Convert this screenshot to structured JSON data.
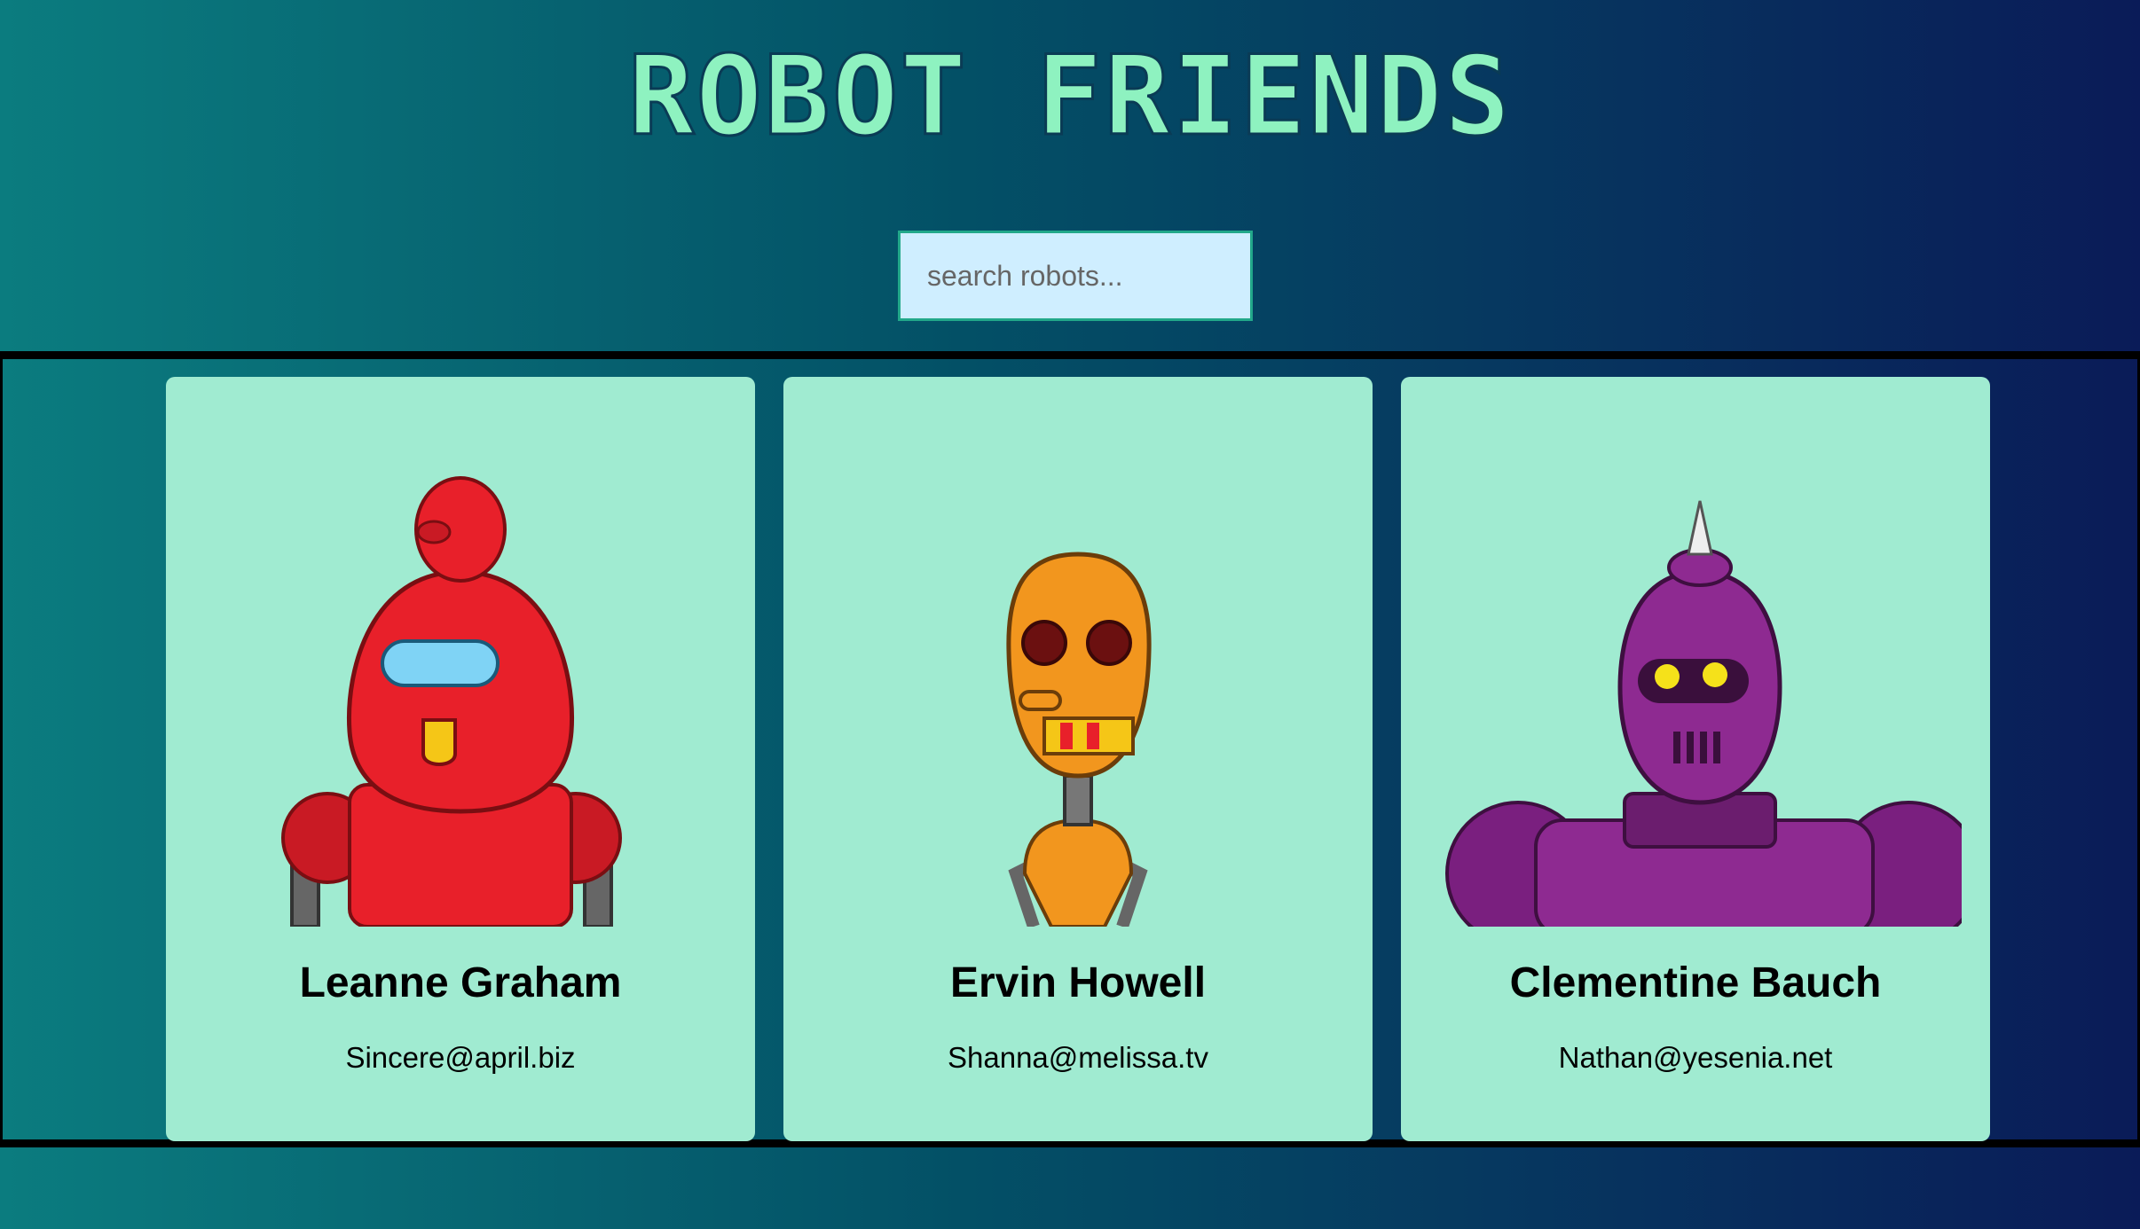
{
  "app": {
    "title": "ROBOT FRIENDS"
  },
  "search": {
    "placeholder": "search robots...",
    "value": ""
  },
  "robots": [
    {
      "name": "Leanne Graham",
      "email": "Sincere@april.biz",
      "avatar_color": "#e8202a"
    },
    {
      "name": "Ervin Howell",
      "email": "Shanna@melissa.tv",
      "avatar_color": "#f2961e"
    },
    {
      "name": "Clementine Bauch",
      "email": "Nathan@yesenia.net",
      "avatar_color": "#8e2a91"
    }
  ],
  "colors": {
    "title": "#8ef2c0",
    "card": "#a0ebd1",
    "search_bg": "#cfeeff"
  }
}
